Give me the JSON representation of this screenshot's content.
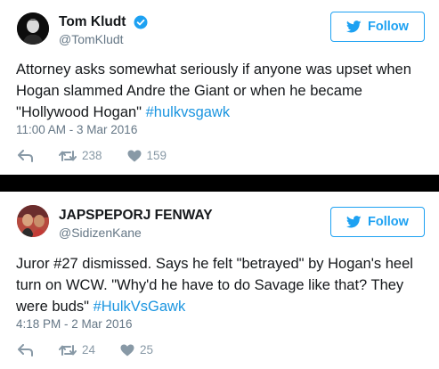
{
  "tweets": [
    {
      "display_name": "Tom Kludt",
      "handle": "@TomKludt",
      "verified": true,
      "follow_label": "Follow",
      "text": "Attorney asks somewhat seriously if anyone was upset when Hogan slammed Andre the Giant or when he became \"Hollywood Hogan\" ",
      "hashtag": "#hulkvsgawk",
      "timestamp": "11:00 AM - 3 Mar 2016",
      "retweets": "238",
      "likes": "159"
    },
    {
      "display_name": "JAPSPEPORJ FENWAY",
      "handle": "@SidizenKane",
      "verified": false,
      "follow_label": "Follow",
      "text": "Juror #27 dismissed. Says he felt \"betrayed\" by Hogan's heel turn on WCW. \"Why'd he have to do Savage like that? They were buds\" ",
      "hashtag": "#HulkVsGawk",
      "timestamp": "4:18 PM - 2 Mar 2016",
      "retweets": "24",
      "likes": "25"
    }
  ],
  "colors": {
    "accent": "#1da1f2",
    "link": "#1b95e0",
    "muted": "#657786",
    "icons": "#8899a6",
    "divider": "#000000"
  },
  "icons": [
    "verified-badge-icon",
    "twitter-bird-icon",
    "reply-icon",
    "retweet-icon",
    "like-icon"
  ]
}
